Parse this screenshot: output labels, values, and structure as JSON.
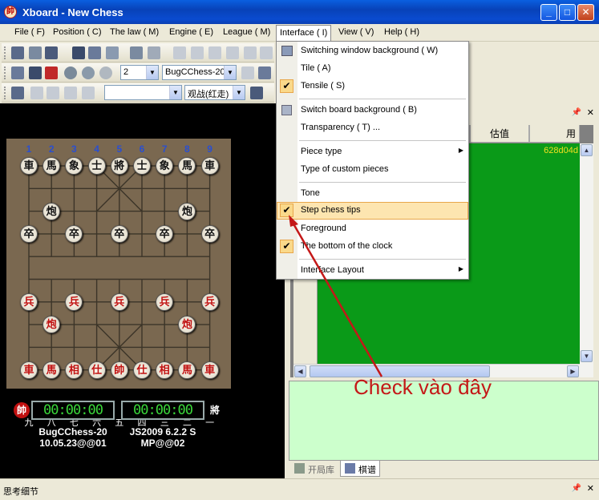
{
  "window": {
    "title": "Xboard - New Chess",
    "app_icon": "帥"
  },
  "menubar": {
    "items": [
      "File ( F)",
      "Position ( C)",
      "The law ( M)",
      "Engine ( E)",
      "League ( M)",
      "Interface ( I)",
      "View ( V)",
      "Help ( H)"
    ]
  },
  "toolbar2": {
    "depth_value": "2",
    "engine_value": "BugCChess-20"
  },
  "toolbar3": {
    "mode_value": "",
    "watch_value": "观战(红走)"
  },
  "board": {
    "col_numbers_top": [
      "1",
      "2",
      "3",
      "4",
      "5",
      "6",
      "7",
      "8",
      "9"
    ],
    "col_numbers_bottom": [
      "九",
      "八",
      "七",
      "六",
      "五",
      "四",
      "三",
      "二",
      "一"
    ],
    "black_pieces": [
      {
        "c": 0,
        "r": 0,
        "t": "車"
      },
      {
        "c": 1,
        "r": 0,
        "t": "馬"
      },
      {
        "c": 2,
        "r": 0,
        "t": "象"
      },
      {
        "c": 3,
        "r": 0,
        "t": "士"
      },
      {
        "c": 4,
        "r": 0,
        "t": "將"
      },
      {
        "c": 5,
        "r": 0,
        "t": "士"
      },
      {
        "c": 6,
        "r": 0,
        "t": "象"
      },
      {
        "c": 7,
        "r": 0,
        "t": "馬"
      },
      {
        "c": 8,
        "r": 0,
        "t": "車"
      },
      {
        "c": 1,
        "r": 2,
        "t": "炮"
      },
      {
        "c": 7,
        "r": 2,
        "t": "炮"
      },
      {
        "c": 0,
        "r": 3,
        "t": "卒"
      },
      {
        "c": 2,
        "r": 3,
        "t": "卒"
      },
      {
        "c": 4,
        "r": 3,
        "t": "卒"
      },
      {
        "c": 6,
        "r": 3,
        "t": "卒"
      },
      {
        "c": 8,
        "r": 3,
        "t": "卒"
      }
    ],
    "red_pieces": [
      {
        "c": 0,
        "r": 6,
        "t": "兵"
      },
      {
        "c": 2,
        "r": 6,
        "t": "兵"
      },
      {
        "c": 4,
        "r": 6,
        "t": "兵"
      },
      {
        "c": 6,
        "r": 6,
        "t": "兵"
      },
      {
        "c": 8,
        "r": 6,
        "t": "兵"
      },
      {
        "c": 1,
        "r": 7,
        "t": "炮"
      },
      {
        "c": 7,
        "r": 7,
        "t": "炮"
      },
      {
        "c": 0,
        "r": 9,
        "t": "車"
      },
      {
        "c": 1,
        "r": 9,
        "t": "馬"
      },
      {
        "c": 2,
        "r": 9,
        "t": "相"
      },
      {
        "c": 3,
        "r": 9,
        "t": "仕"
      },
      {
        "c": 4,
        "r": 9,
        "t": "帥"
      },
      {
        "c": 5,
        "r": 9,
        "t": "仕"
      },
      {
        "c": 6,
        "r": 9,
        "t": "相"
      },
      {
        "c": 7,
        "r": 9,
        "t": "馬"
      },
      {
        "c": 8,
        "r": 9,
        "t": "車"
      }
    ]
  },
  "clocks": {
    "red_icon": "帥",
    "black_icon": "將",
    "red_time": "00:00:00",
    "black_time": "00:00:00"
  },
  "players": {
    "red_line1": "BugCChess-20",
    "red_line2": "10.05.23@@01",
    "black_line1": "JS2009 6.2.2 S",
    "black_line2": "MP@@02"
  },
  "analysis": {
    "columns": [
      "估值",
      "用"
    ],
    "first_value": "628d04d"
  },
  "tabs": [
    {
      "label": "开局库"
    },
    {
      "label": "棋谱"
    }
  ],
  "statusbar": {
    "label": "思考细节"
  },
  "interface_menu": {
    "items": [
      {
        "label": "Switching window background ( W)",
        "icon": "image-icon"
      },
      {
        "label": "Tile ( A)"
      },
      {
        "label": "Tensile ( S)",
        "checked": true
      },
      {
        "label": "Switch board background ( B)",
        "icon": "board-icon"
      },
      {
        "label": "Transparency ( T) ..."
      },
      {
        "label": "Piece type",
        "submenu": true
      },
      {
        "label": "Type of custom pieces"
      },
      {
        "label": "Tone"
      },
      {
        "label": "Step chess tips",
        "checked": true,
        "highlighted": true
      },
      {
        "label": "Foreground"
      },
      {
        "label": "The bottom of the clock",
        "checked": true
      },
      {
        "label": "Interface Layout",
        "submenu": true
      }
    ]
  },
  "annotation": {
    "text": "Check vào đây",
    "color": "#c41818"
  }
}
